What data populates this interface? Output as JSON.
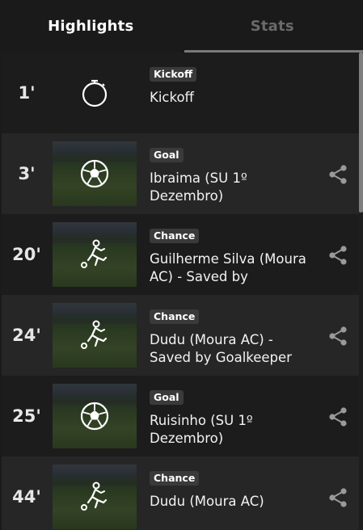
{
  "tabs": [
    {
      "label": "Highlights",
      "active": true
    },
    {
      "label": "Stats",
      "active": false
    }
  ],
  "events": [
    {
      "minute": "1'",
      "badge": "Kickoff",
      "title": "Kickoff",
      "icon": "stopwatch-icon",
      "has_video": false,
      "shareable": false
    },
    {
      "minute": "3'",
      "badge": "Goal",
      "title": "Ibraima (SU 1º Dezembro)",
      "icon": "soccer-ball-icon",
      "has_video": true,
      "shareable": true
    },
    {
      "minute": "20'",
      "badge": "Chance",
      "title": "Guilherme Silva (Moura AC) - Saved by",
      "icon": "kicking-player-icon",
      "has_video": true,
      "shareable": true
    },
    {
      "minute": "24'",
      "badge": "Chance",
      "title": "Dudu (Moura AC) - Saved by Goalkeeper",
      "icon": "kicking-player-icon",
      "has_video": true,
      "shareable": true
    },
    {
      "minute": "25'",
      "badge": "Goal",
      "title": "Ruisinho (SU 1º Dezembro)",
      "icon": "soccer-ball-icon",
      "has_video": true,
      "shareable": true
    },
    {
      "minute": "44'",
      "badge": "Chance",
      "title": "Dudu (Moura AC)",
      "icon": "kicking-player-icon",
      "has_video": true,
      "shareable": true
    }
  ],
  "colors": {
    "background": "#1a1a1a",
    "row_alt": "#262626",
    "badge_bg": "#3a3a3a",
    "tab_indicator": "#7a7a7a",
    "share_icon": "#9a9a9a"
  }
}
